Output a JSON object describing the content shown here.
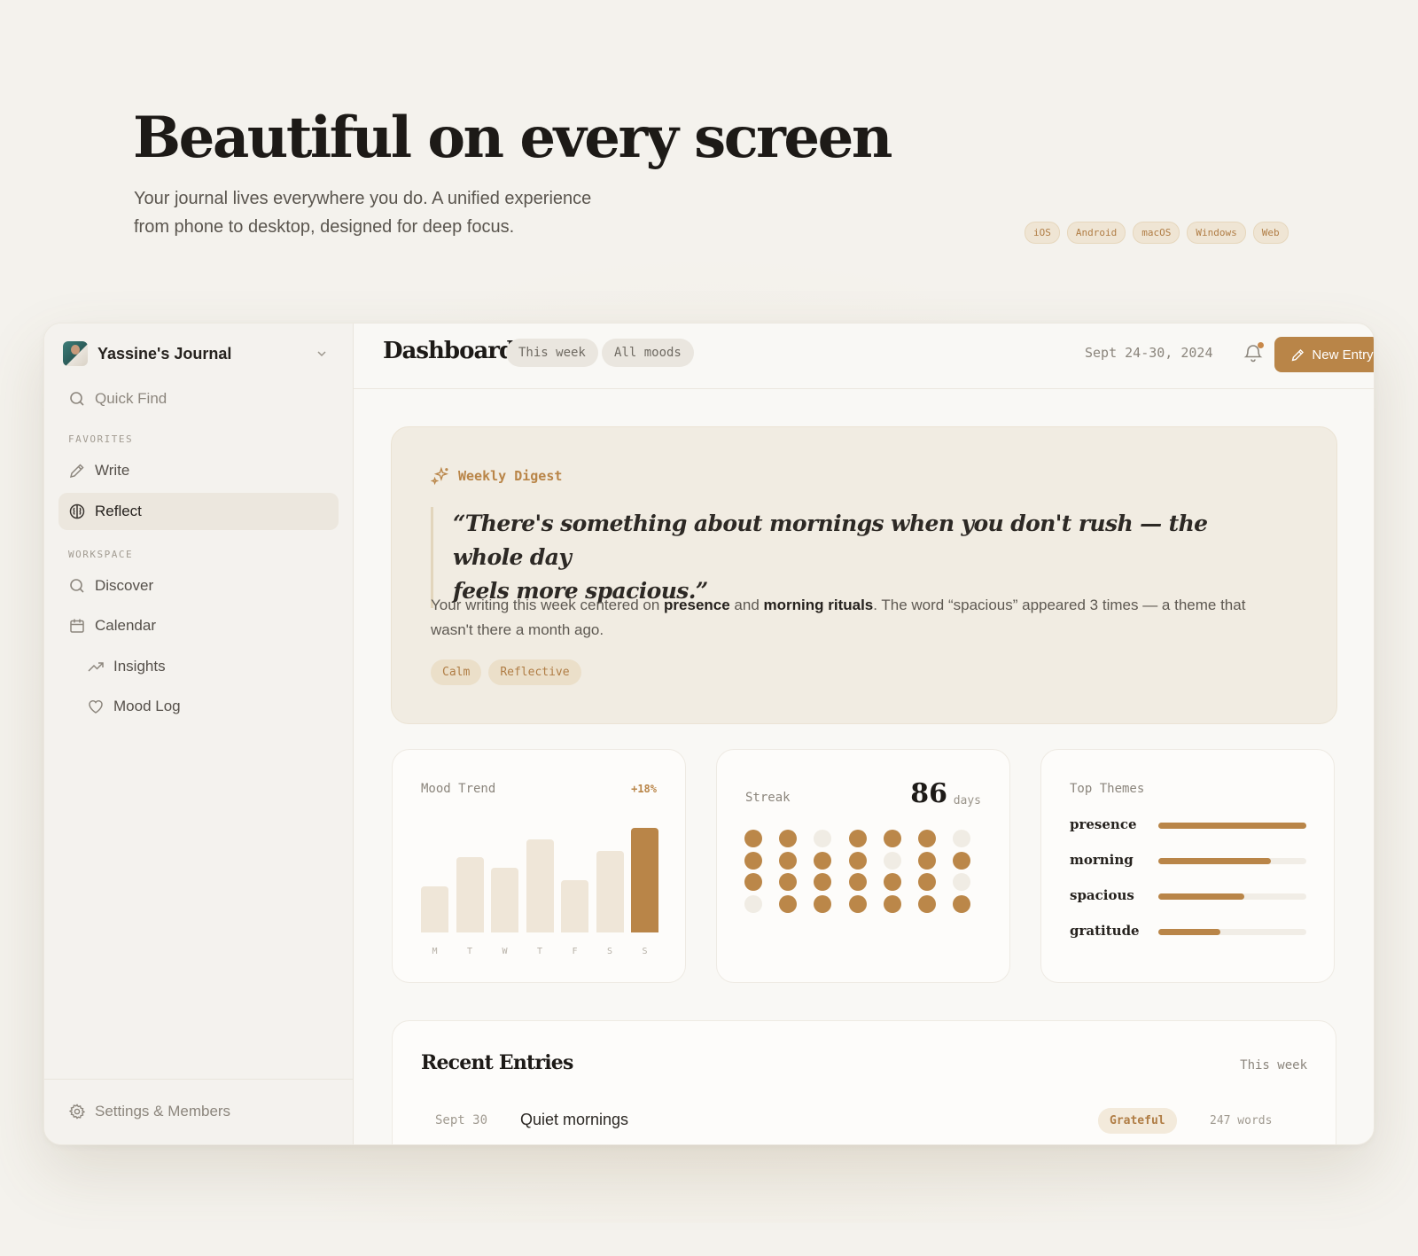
{
  "hero": {
    "title": "Beautiful on every screen",
    "subtitle_line1": "Your journal lives everywhere you do. A unified experience",
    "subtitle_line2": "from phone to desktop, designed for deep focus.",
    "platforms": [
      "iOS",
      "Android",
      "macOS",
      "Windows",
      "Web"
    ]
  },
  "sidebar": {
    "workspace_name": "Yassine's Journal",
    "quick_find": "Quick Find",
    "favorites_label": "FAVORITES",
    "favorites": [
      {
        "label": "Write",
        "icon": "pencil-icon"
      },
      {
        "label": "Reflect",
        "icon": "brain-icon",
        "active": true
      }
    ],
    "workspace_label": "WORKSPACE",
    "workspace_items": [
      {
        "label": "Discover",
        "icon": "search-icon"
      },
      {
        "label": "Calendar",
        "icon": "calendar-icon"
      },
      {
        "label": "Insights",
        "icon": "trend-icon"
      },
      {
        "label": "Mood Log",
        "icon": "heart-icon"
      }
    ],
    "footer": "Settings & Members"
  },
  "topbar": {
    "title": "Dashboard",
    "filter_week": "This week",
    "filter_moods": "All moods",
    "date_range": "Sept 24-30, 2024",
    "new_entry": "New Entry"
  },
  "digest": {
    "label": "Weekly Digest",
    "quote_line1": "“There's something about mornings when you don't rush — the whole day",
    "quote_line2": "feels more spacious.”",
    "summary_pre": "Your writing this week centered on ",
    "summary_b1": "presence",
    "summary_mid": " and ",
    "summary_b2": "morning rituals",
    "summary_post": ". The word “spacious” appeared 3 times — a theme that wasn't there a month ago.",
    "tags": [
      "Calm",
      "Reflective"
    ]
  },
  "mood_trend": {
    "label": "Mood Trend",
    "change": "+18%",
    "days": [
      "M",
      "T",
      "W",
      "T",
      "F",
      "S",
      "S"
    ],
    "values": [
      0.44,
      0.72,
      0.62,
      0.89,
      0.5,
      0.78,
      1.0
    ],
    "highlight_index": 6
  },
  "streak": {
    "label": "Streak",
    "count": "86",
    "unit": "days",
    "grid": [
      [
        1,
        1,
        0,
        1,
        1,
        1,
        0
      ],
      [
        1,
        1,
        1,
        1,
        0,
        1,
        1
      ],
      [
        1,
        1,
        1,
        1,
        1,
        1,
        0
      ],
      [
        0,
        1,
        1,
        1,
        1,
        1,
        1
      ]
    ]
  },
  "top_themes": {
    "label": "Top Themes",
    "items": [
      {
        "name": "presence",
        "value": 1.0
      },
      {
        "name": "morning",
        "value": 0.76
      },
      {
        "name": "spacious",
        "value": 0.58
      },
      {
        "name": "gratitude",
        "value": 0.42
      }
    ]
  },
  "recent": {
    "title": "Recent Entries",
    "range": "This week",
    "entries": [
      {
        "date": "Sept 30",
        "title": "Quiet mornings",
        "mood": "Grateful",
        "words": "247 words"
      }
    ]
  },
  "colors": {
    "accent": "#b98548",
    "accent_soft": "#efe6d8",
    "background": "#f4f2ed"
  }
}
